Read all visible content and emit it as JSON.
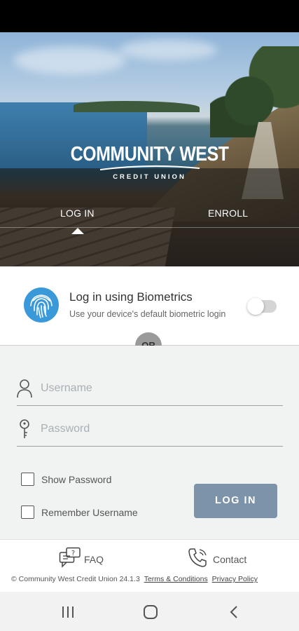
{
  "brand": {
    "name": "COMMUNITY WEST",
    "subtitle": "CREDIT UNION"
  },
  "tabs": [
    {
      "label": "LOG IN",
      "active": true
    },
    {
      "label": "ENROLL",
      "active": false
    }
  ],
  "biometrics": {
    "title": "Log in using Biometrics",
    "subtitle": "Use your device's default biometric login",
    "enabled": false,
    "icon": "fingerprint-icon"
  },
  "divider": {
    "label": "OR"
  },
  "form": {
    "username": {
      "placeholder": "Username",
      "value": "",
      "icon": "user-icon"
    },
    "password": {
      "placeholder": "Password",
      "value": "",
      "icon": "key-icon"
    },
    "show_password": {
      "label": "Show Password",
      "checked": false
    },
    "remember_username": {
      "label": "Remember Username",
      "checked": false
    },
    "login_label": "LOG IN"
  },
  "footer": {
    "faq_label": "FAQ",
    "contact_label": "Contact",
    "copyright": "© Community West Credit Union 24.1.3",
    "terms_label": "Terms & Conditions",
    "privacy_label": "Privacy Policy"
  },
  "colors": {
    "accent": "#7d93a9",
    "fingerprint": "#3a9ad9",
    "or_badge": "#9a9a9a"
  }
}
